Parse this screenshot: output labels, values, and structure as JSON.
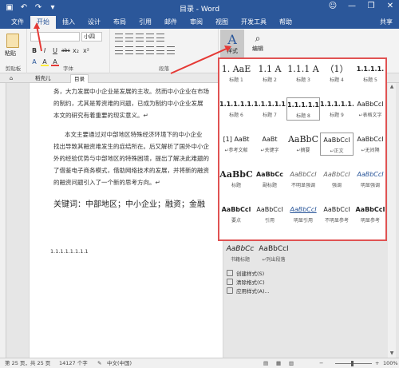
{
  "window": {
    "title": "目录 - Word",
    "login_icon": "user-icon",
    "controls": [
      "—",
      "❐",
      "✕"
    ],
    "quick_access": [
      "save-icon",
      "undo-icon",
      "redo-icon",
      "customize-icon"
    ]
  },
  "tabs": [
    {
      "label": "文件",
      "active": false
    },
    {
      "label": "开始",
      "active": true
    },
    {
      "label": "插入",
      "active": false
    },
    {
      "label": "设计",
      "active": false
    },
    {
      "label": "布局",
      "active": false
    },
    {
      "label": "引用",
      "active": false
    },
    {
      "label": "邮件",
      "active": false
    },
    {
      "label": "审阅",
      "active": false
    },
    {
      "label": "视图",
      "active": false
    },
    {
      "label": "开发工具",
      "active": false
    },
    {
      "label": "帮助",
      "active": false
    }
  ],
  "share_label": "共享",
  "ribbon": {
    "clipboard": {
      "label": "剪贴板",
      "paste": "粘贴"
    },
    "font": {
      "label": "字体",
      "font_name": "",
      "font_size": "小四",
      "buttons": [
        "B",
        "I",
        "U",
        "abc",
        "x₂",
        "x²",
        "A",
        "A",
        "A"
      ]
    },
    "paragraph": {
      "label": "段落"
    },
    "styles": {
      "label": "样式",
      "icon_text": "A"
    },
    "editing": {
      "label": "编辑"
    }
  },
  "doc_tabs": [
    {
      "label": "稻壳儿"
    },
    {
      "label": "目录"
    }
  ],
  "document": {
    "para1": [
      "务，大力发展中小企业是发展的主攻。然而中小企业在市场",
      "的制约，尤其是筹资难的问题，已成为制约中小企业发展",
      "本文的研究有着重要的现实意义。↵"
    ],
    "para2": [
      "本文主要通过对中部地区特殊经济环境下的中小企业",
      "找出导致其融资难发生的症结所在。后又解析了国外中小企",
      "外的经验优势与中部地区的特殊困境，提出了解决此难题的",
      "了借鉴电子商务模式，借助网络技术的发展，并将新的融资",
      "的融资问题引入了一个新的思考方向。↵"
    ],
    "keywords": "关键词：中部地区；中小企业；融资；金融",
    "toc_line": "1.1.1.1.1.1.1.1"
  },
  "gallery": {
    "rows": [
      [
        {
          "s": "1. AaE",
          "n": "标题 1",
          "style": "big"
        },
        {
          "s": "1.1 A",
          "n": "标题 2",
          "style": "big"
        },
        {
          "s": "1.1.1 A",
          "n": "标题 3",
          "style": "big"
        },
        {
          "s": "（1）",
          "n": "标题 4",
          "style": "big"
        },
        {
          "s": "1.1.1.1.",
          "n": "标题 5",
          "style": "bold"
        }
      ],
      [
        {
          "s": "1.1.1.1.1.",
          "n": "标题 6",
          "style": "bold"
        },
        {
          "s": "1.1.1.1.1",
          "n": "标题 7",
          "style": "bold"
        },
        {
          "s": "1.1.1.1.1.",
          "n": "标题 8",
          "style": "boldsel"
        },
        {
          "s": "1.1.1.1.1.",
          "n": "标题 9",
          "style": "bold"
        },
        {
          "s": "AaBbCcI",
          "n": "↵表格文字",
          "style": "small"
        }
      ],
      [
        {
          "s": "[1] AaBt",
          "n": "↵参考文献",
          "style": "small"
        },
        {
          "s": "AaBt",
          "n": "↵关键字",
          "style": "small"
        },
        {
          "s": "AaBbC",
          "n": "↵摘要",
          "style": "big"
        },
        {
          "s": "AaBbCcI",
          "n": "↵正文",
          "style": "smallsel"
        },
        {
          "s": "AaBbCcI",
          "n": "↵无间隔",
          "style": "small"
        }
      ],
      [
        {
          "s": "AaBbC",
          "n": "标题",
          "style": "bigbold"
        },
        {
          "s": "AaBbCc",
          "n": "副标题",
          "style": "bold"
        },
        {
          "s": "AaBbCcI",
          "n": "不明显强调",
          "style": "italic"
        },
        {
          "s": "AaBbCcI",
          "n": "强调",
          "style": "italic"
        },
        {
          "s": "AaBbCcI",
          "n": "明显强调",
          "style": "italicblue"
        }
      ],
      [
        {
          "s": "AaBbCcl",
          "n": "要点",
          "style": "bold"
        },
        {
          "s": "AaBbCcI",
          "n": "引用",
          "style": "small"
        },
        {
          "s": "AaBbCcI",
          "n": "明显引用",
          "style": "italicline"
        },
        {
          "s": "AaBbCcI",
          "n": "不明显参考",
          "style": "small"
        },
        {
          "s": "AaBbCcI",
          "n": "明显参考",
          "style": "smallbold"
        }
      ]
    ],
    "below": [
      {
        "s": "AaBbCc",
        "n": "书籍标题"
      },
      {
        "s": "AaBbCcI",
        "n": "↵列出段落"
      }
    ],
    "menu": [
      "创建样式(S)",
      "清除格式(C)",
      "应用样式(A)..."
    ]
  },
  "statusbar": {
    "page": "第 25 页，共 25 页",
    "words": "14127 个字",
    "lang_icon": "proofing-icon",
    "lang": "中文(中国)",
    "zoom": "100%",
    "zoom_fraction": 0.45
  }
}
